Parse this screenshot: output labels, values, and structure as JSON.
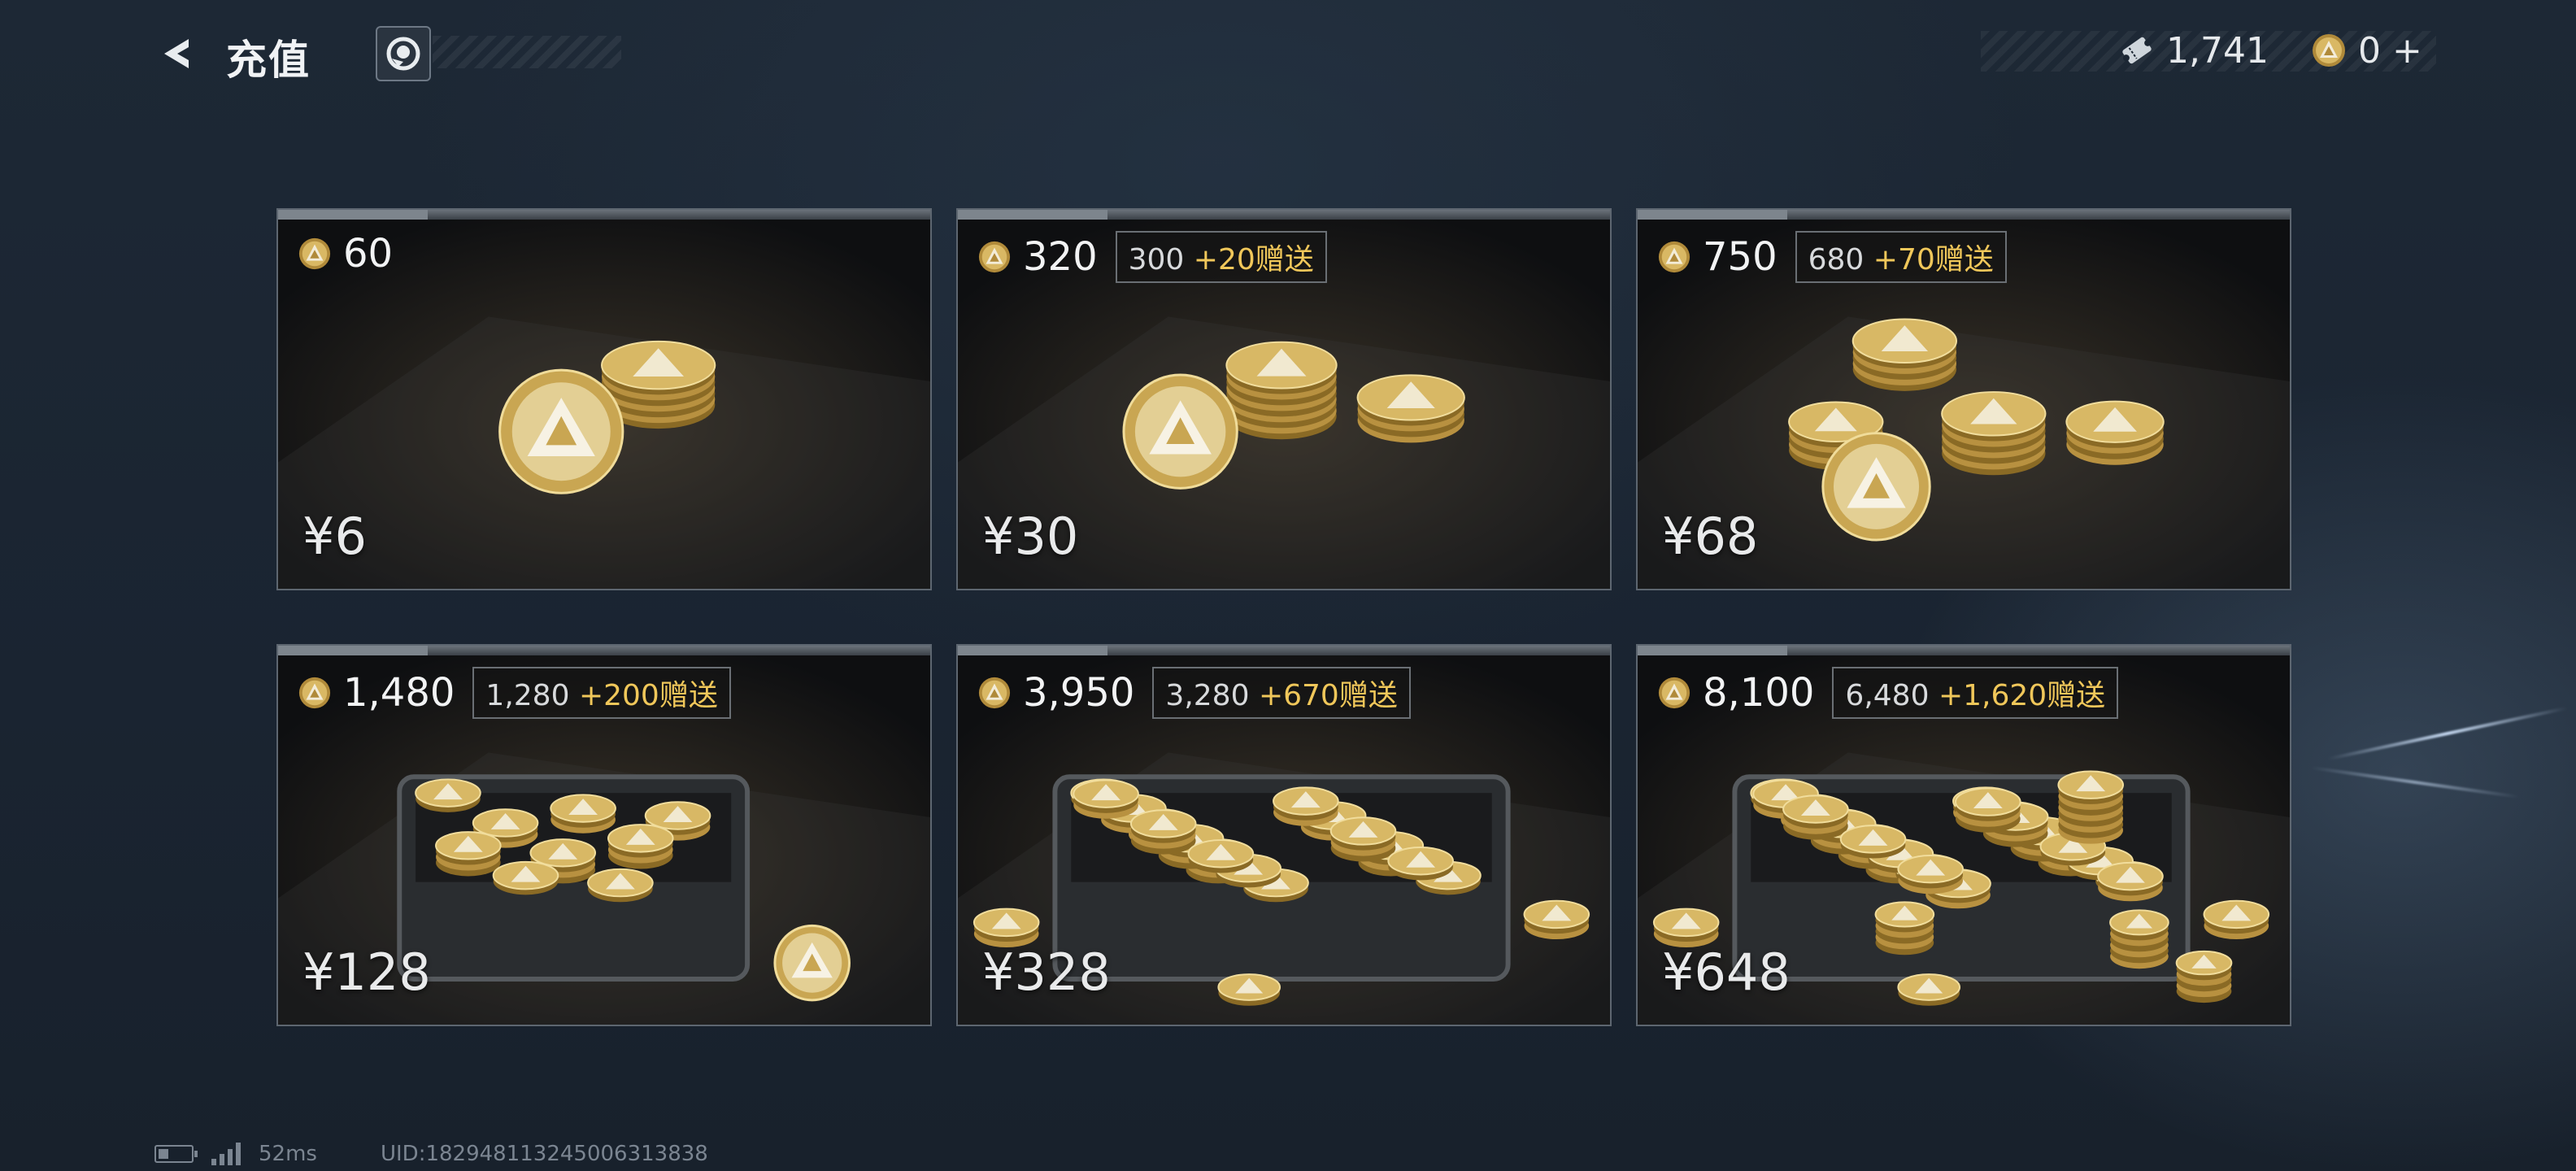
{
  "header": {
    "title": "充值",
    "back_icon": "back-arrow-icon",
    "support_icon": "headset-icon"
  },
  "currencies": {
    "ticket_value": "1,741",
    "coin_value": "0",
    "coin_add": "+"
  },
  "packages": [
    {
      "amount": "60",
      "base": "",
      "extra": "",
      "price": "¥6",
      "tier": 1
    },
    {
      "amount": "320",
      "base": "300",
      "extra": "+20赠送",
      "price": "¥30",
      "tier": 2
    },
    {
      "amount": "750",
      "base": "680",
      "extra": "+70赠送",
      "price": "¥68",
      "tier": 3
    },
    {
      "amount": "1,480",
      "base": "1,280",
      "extra": "+200赠送",
      "price": "¥128",
      "tier": 4
    },
    {
      "amount": "3,950",
      "base": "3,280",
      "extra": "+670赠送",
      "price": "¥328",
      "tier": 5
    },
    {
      "amount": "8,100",
      "base": "6,480",
      "extra": "+1,620赠送",
      "price": "¥648",
      "tier": 6
    }
  ],
  "status": {
    "latency": "52ms",
    "uid": "UID:182948113245006313838"
  },
  "colors": {
    "accent_gold": "#f0c75a",
    "background": "#1b2633"
  }
}
